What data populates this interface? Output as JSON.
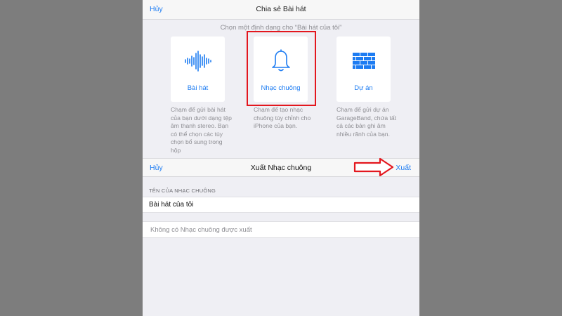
{
  "share_sheet": {
    "cancel_label": "Hủy",
    "title": "Chia sẻ Bài hát",
    "subtitle": "Chọn một định dạng cho “Bài hát của tôi”",
    "options": [
      {
        "label": "Bài hát",
        "icon": "waveform-icon",
        "description": "Chạm để gửi bài hát của bạn dưới dạng tệp âm thanh stereo. Bạn có thể chọn các tùy chọn bổ sung trong hộp"
      },
      {
        "label": "Nhạc chuông",
        "icon": "bell-icon",
        "description": "Chạm để tạo nhạc chuông tùy chỉnh cho iPhone của bạn."
      },
      {
        "label": "Dự án",
        "icon": "brick-wall-icon",
        "description": "Chạm để gửi dự án GarageBand, chứa tất cả các bản ghi âm nhiều rãnh của bạn."
      }
    ]
  },
  "export_sheet": {
    "cancel_label": "Hủy",
    "title": "Xuất Nhạc chuông",
    "export_label": "Xuất",
    "section_header": "TÊN CỦA NHẠC CHUÔNG",
    "ringtone_name": "Bài hát của tôi",
    "empty_message": "Không có Nhạc chuông được xuất"
  },
  "colors": {
    "accent": "#1d7cf2",
    "annotation": "#e3171e"
  }
}
